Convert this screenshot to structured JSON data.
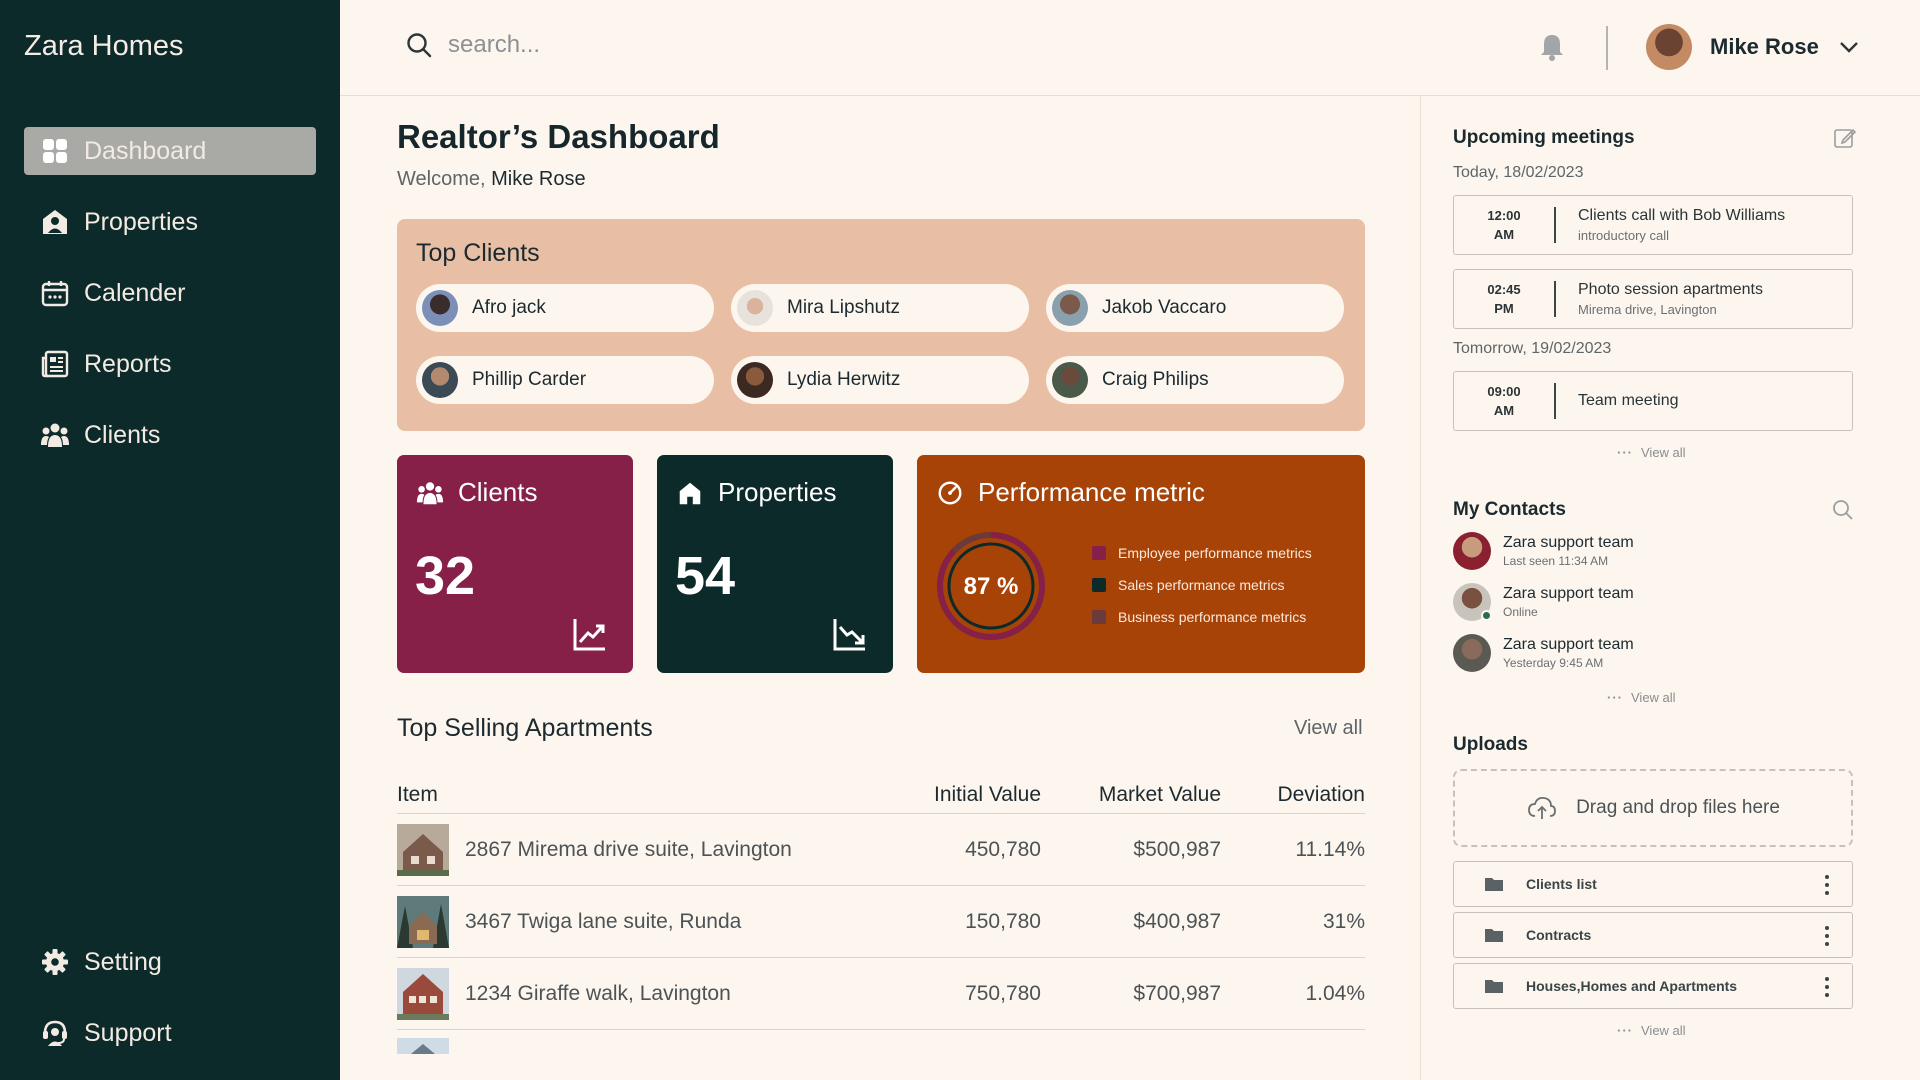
{
  "app": {
    "brand": "Zara Homes"
  },
  "sidebar": {
    "items": [
      {
        "label": "Dashboard",
        "icon": "grid-icon",
        "active": true
      },
      {
        "label": "Properties",
        "icon": "home-user-icon"
      },
      {
        "label": "Calender",
        "icon": "calendar-icon"
      },
      {
        "label": "Reports",
        "icon": "reports-icon"
      },
      {
        "label": "Clients",
        "icon": "users-icon"
      }
    ],
    "bottom": [
      {
        "label": "Setting",
        "icon": "gear-icon"
      },
      {
        "label": "Support",
        "icon": "headset-icon"
      }
    ]
  },
  "header": {
    "search_placeholder": "search...",
    "user_name": "Mike Rose"
  },
  "main": {
    "title": "Realtor’s  Dashboard",
    "welcome_prefix": "Welcome,",
    "welcome_name": "Mike Rose",
    "top_clients": {
      "title": "Top Clients",
      "clients": [
        "Afro jack",
        "Mira Lipshutz",
        "Jakob Vaccaro",
        "Phillip Carder",
        "Lydia Herwitz",
        "Craig Philips"
      ]
    },
    "cards": {
      "clients": {
        "title": "Clients",
        "value": "32",
        "color": "#862048"
      },
      "properties": {
        "title": "Properties",
        "value": "54",
        "color": "#0d2a2b"
      },
      "performance": {
        "title": "Performance metric",
        "value_label": "87 %",
        "percent": 87,
        "color": "#a84307",
        "legend": [
          {
            "label": "Employee performance metrics",
            "color": "#862048"
          },
          {
            "label": "Sales performance metrics",
            "color": "#0d2a2b"
          },
          {
            "label": "Business performance metrics",
            "color": "#6b3a3a"
          }
        ]
      }
    },
    "top_selling": {
      "title": "Top Selling Apartments",
      "view_all": "View all",
      "columns": [
        "Item",
        "Initial Value",
        "Market Value",
        "Deviation"
      ],
      "rows": [
        {
          "item": "2867 Mirema drive suite, Lavington",
          "initial": "450,780",
          "market": "$500,987",
          "deviation": "11.14%"
        },
        {
          "item": "3467 Twiga lane suite, Runda",
          "initial": "150,780",
          "market": "$400,987",
          "deviation": "31%"
        },
        {
          "item": "1234 Giraffe walk, Lavington",
          "initial": "750,780",
          "market": "$700,987",
          "deviation": "1.04%"
        }
      ]
    }
  },
  "right": {
    "meetings": {
      "title": "Upcoming meetings",
      "today": "Today, 18/02/2023",
      "tomorrow": "Tomorrow, 19/02/2023",
      "items": [
        {
          "time": "12:00",
          "ampm": "AM",
          "title": "Clients call with Bob Williams",
          "desc": "introductory call"
        },
        {
          "time": "02:45",
          "ampm": "PM",
          "title": "Photo session apartments",
          "desc": "Mirema drive, Lavington"
        },
        {
          "time": "09:00",
          "ampm": "AM",
          "title": "Team meeting",
          "desc": ""
        }
      ],
      "view_all": "View all"
    },
    "contacts": {
      "title": "My Contacts",
      "items": [
        {
          "name": "Zara support team",
          "status": "Last seen 11:34 AM"
        },
        {
          "name": "Zara support team",
          "status": "Online"
        },
        {
          "name": "Zara support team",
          "status": "Yesterday 9:45 AM"
        }
      ],
      "view_all": "View all"
    },
    "uploads": {
      "title": "Uploads",
      "dropzone": "Drag and drop files here",
      "folders": [
        "Clients  list",
        "Contracts",
        "Houses,Homes and Apartments"
      ],
      "view_all": "View all"
    }
  }
}
